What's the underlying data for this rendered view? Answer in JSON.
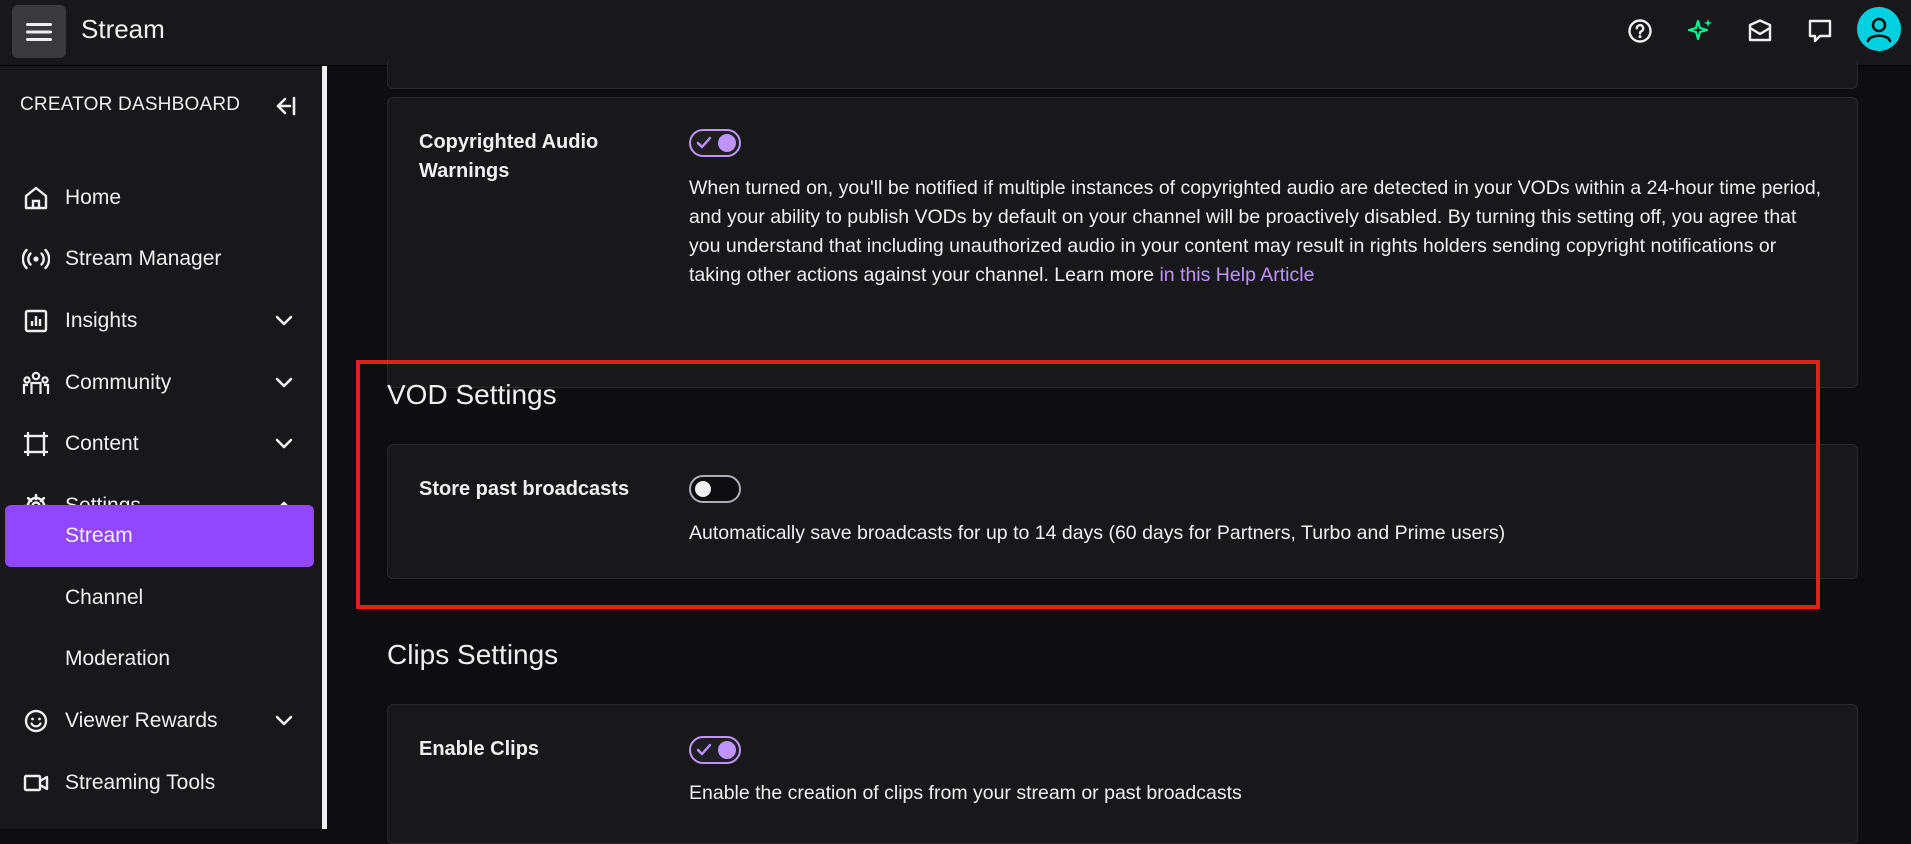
{
  "topbar": {
    "title": "Stream",
    "icons": [
      "menu-icon",
      "help-icon",
      "sparkle-icon",
      "inbox-icon",
      "whispers-icon",
      "avatar-icon"
    ],
    "accent": "#00d0e0",
    "sparkle_color": "#00f593"
  },
  "sidebar": {
    "header": "CREATOR DASHBOARD",
    "items": [
      {
        "label": "Home",
        "icon": "home-icon"
      },
      {
        "label": "Stream Manager",
        "icon": "broadcast-icon"
      },
      {
        "label": "Insights",
        "icon": "insights-icon",
        "expandable": true
      },
      {
        "label": "Community",
        "icon": "community-icon",
        "expandable": true
      },
      {
        "label": "Content",
        "icon": "content-icon",
        "expandable": true
      },
      {
        "label": "Settings",
        "icon": "gear-icon",
        "expanded": true
      },
      {
        "label": "Stream",
        "active": true
      },
      {
        "label": "Channel"
      },
      {
        "label": "Moderation"
      },
      {
        "label": "Viewer Rewards",
        "icon": "rewards-icon",
        "expandable": true
      },
      {
        "label": "Streaming Tools",
        "icon": "camera-icon"
      }
    ],
    "active_color": "#9147ff"
  },
  "main": {
    "copyright": {
      "label_line1": "Copyrighted Audio",
      "label_line2": "Warnings",
      "enabled": true,
      "desc": "When turned on, you'll be notified if multiple instances of copyrighted audio are detected in your VODs within a 24-hour time period, and your ability to publish VODs by default on your channel will be proactively disabled. By turning this setting off, you agree that you understand that including unauthorized audio in your content may result in rights holders sending copyright notifications or taking other actions against your channel. Learn more ",
      "link": "in this Help Article"
    },
    "vod": {
      "section_title": "VOD Settings",
      "label": "Store past broadcasts",
      "enabled": false,
      "desc": "Automatically save broadcasts for up to 14 days (60 days for Partners, Turbo and Prime users)"
    },
    "clips": {
      "section_title": "Clips Settings",
      "label": "Enable Clips",
      "enabled": true,
      "desc": "Enable the creation of clips from your stream or past broadcasts"
    }
  }
}
